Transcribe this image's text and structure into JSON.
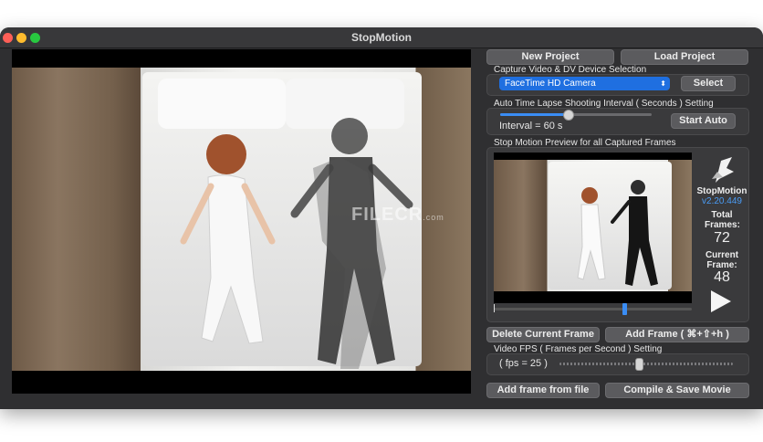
{
  "window": {
    "title": "StopMotion"
  },
  "buttons": {
    "new_project": "New  Project",
    "load_project": "Load  Project",
    "select": "Select",
    "start_auto": "Start Auto",
    "delete_frame": "Delete Current Frame",
    "add_frame": "Add Frame  ( ⌘+⇧+h )",
    "add_from_file": "Add frame from file",
    "compile_save": "Compile & Save Movie"
  },
  "capture": {
    "heading": "Capture Video & DV Device Selection",
    "device_selected": "FaceTime HD Camera"
  },
  "timelapse": {
    "heading": "Auto Time Lapse Shooting Interval ( Seconds ) Setting",
    "interval_text": "Interval = 60 s",
    "slider_fraction": 0.45
  },
  "preview": {
    "heading": "Stop Motion Preview for all Captured Frames",
    "scrub_fraction": 0.66
  },
  "app_info": {
    "name": "StopMotion",
    "version": "v2.20.449",
    "total_label": "Total Frames:",
    "total_value": "72",
    "current_label": "Current Frame:",
    "current_value": "48"
  },
  "fps": {
    "heading": "Video FPS ( Frames per Second ) Setting",
    "value_text": "( fps = 25 )",
    "slider_fraction": 0.46
  },
  "watermark": {
    "text": "FILECR",
    "suffix": ".com"
  },
  "colors": {
    "accent": "#3a8df5",
    "window_bg": "#2f2f31",
    "version": "#4a9cf5"
  }
}
